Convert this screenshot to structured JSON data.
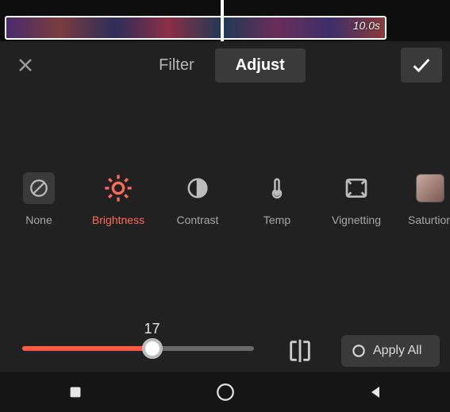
{
  "timeline": {
    "clip_duration_label": "10.0s"
  },
  "header": {
    "tabs": {
      "filter": "Filter",
      "adjust": "Adjust",
      "active": "adjust"
    }
  },
  "adjust_options": {
    "none": {
      "label": "None"
    },
    "brightness": {
      "label": "Brightness",
      "selected": true
    },
    "contrast": {
      "label": "Contrast"
    },
    "temp": {
      "label": "Temp"
    },
    "vignetting": {
      "label": "Vignetting"
    },
    "saturation": {
      "label": "Saturtion"
    }
  },
  "slider": {
    "value": 17,
    "min": -100,
    "max": 100,
    "percent_of_track": 56
  },
  "apply_all_label": "Apply All",
  "colors": {
    "accent": "#ff5a47",
    "accent_icon": "#ff6b5a",
    "panel": "#212121"
  }
}
